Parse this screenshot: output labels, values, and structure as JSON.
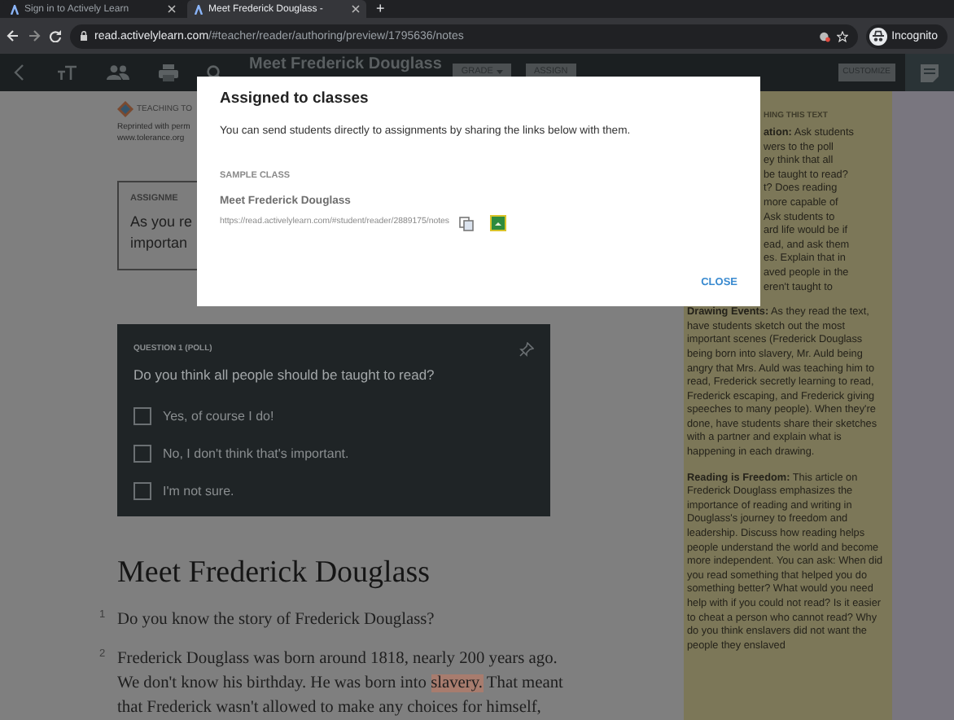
{
  "browser": {
    "tabs": [
      {
        "title": "Sign in to Actively Learn",
        "selected": false
      },
      {
        "title": "Meet Frederick Douglass -",
        "selected": true
      }
    ],
    "new_tab": "+",
    "address": {
      "domain": "read.activelylearn.com",
      "path": "/#teacher/reader/authoring/preview/1795636/notes"
    },
    "profile": "Incognito"
  },
  "toolbar": {
    "title": "Meet Frederick Douglass",
    "buttons": [
      {
        "label": "GRADE",
        "dropdown": true
      },
      {
        "label": "ASSIGN",
        "dropdown": false
      }
    ],
    "customize": "CUSTOMIZE"
  },
  "source": {
    "logo_text": "TEACHING TO",
    "credit_lines": [
      "Reprinted with perm",
      "www.tolerance.org"
    ]
  },
  "assignment": {
    "label": "ASSIGNME",
    "lines": [
      "As you re",
      "importan"
    ]
  },
  "question": {
    "label": "QUESTION 1 (POLL)",
    "prompt": "Do you think all people should be taught to read?",
    "options": [
      {
        "text": "Yes, of course I do!",
        "checked": false
      },
      {
        "text": "No, I don't think that's important.",
        "checked": false
      },
      {
        "text": "I'm not sure.",
        "checked": false
      }
    ]
  },
  "article": {
    "title": "Meet Frederick Douglass",
    "paragraphs": [
      {
        "number": "1",
        "parts": [
          {
            "text": "Do you know the story of Frederick Douglass?",
            "highlighted": false
          }
        ]
      },
      {
        "number": "2",
        "parts": [
          {
            "text": "Frederick Douglass was born around 1818, nearly 200 years ago. We don't know his birthday. He was born into ",
            "highlighted": false
          },
          {
            "text": "slavery.",
            "highlighted": true
          },
          {
            "text": " That meant that Frederick wasn't allowed to make any choices for himself,",
            "highlighted": false
          }
        ]
      }
    ]
  },
  "sidebar": {
    "heading": "HING THIS TEXT",
    "intro_lines": [
      "**ation:** Ask students",
      "wers to the poll",
      "ey think that all",
      "be taught to read?",
      "t? Does reading",
      "more capable of",
      "Ask students to",
      "ard life would be if",
      "ead, and ask them",
      "es. Explain that in",
      "aved people in the",
      "eren't taught to"
    ],
    "paragraphs": [
      "**Drawing Events:** As they read the text, have students sketch out the most important scenes (Frederick Douglass being born into slavery, Mr. Auld being angry that Mrs. Auld was teaching him to read, Frederick secretly learning to read, Frederick escaping, and Frederick giving speeches to many people). When they're done, have students share their sketches with a partner and explain what is happening in each drawing.",
      "**Reading is Freedom:** This article on Frederick Douglass emphasizes the importance of reading and writing in Douglass's journey to freedom and leadership. Discuss how reading helps people understand the world and become more independent. You can ask: When did you read something that helped you do something better? What would you need help with if you could not read? Is it easier to cheat a person who cannot read? Why do you think enslavers did not want the people they enslaved"
    ]
  },
  "modal": {
    "title": "Assigned to classes",
    "description": "You can send students directly to assignments by sharing the links below with them.",
    "class_label": "SAMPLE CLASS",
    "assignment_title": "Meet Frederick Douglass",
    "link": "https://read.activelylearn.com/#student/reader/2889175/notes",
    "close": "CLOSE"
  }
}
